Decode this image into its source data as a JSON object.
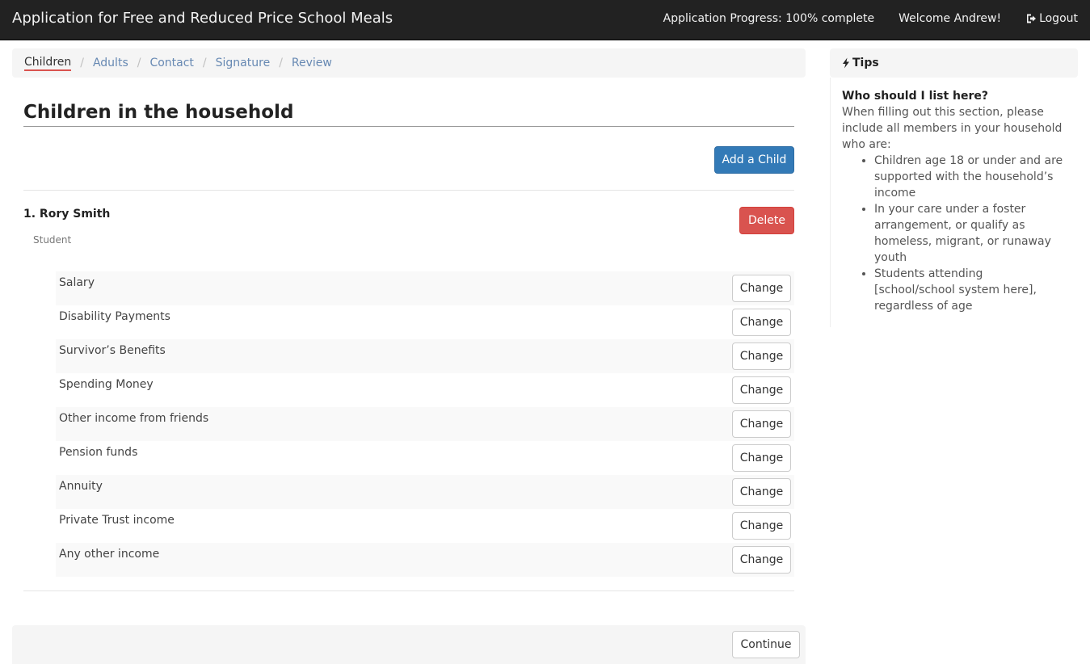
{
  "navbar": {
    "title": "Application for Free and Reduced Price School Meals",
    "progress": "Application Progress: 100% complete",
    "welcome": "Welcome Andrew!",
    "logout_label": "Logout"
  },
  "breadcrumb": {
    "items": [
      {
        "label": "Children",
        "active": true
      },
      {
        "label": "Adults",
        "active": false
      },
      {
        "label": "Contact",
        "active": false
      },
      {
        "label": "Signature",
        "active": false
      },
      {
        "label": "Review",
        "active": false
      }
    ],
    "separator": "/"
  },
  "main": {
    "heading": "Children in the household",
    "add_child_label": "Add a Child",
    "child": {
      "name": "1. Rory Smith",
      "role": "Student",
      "delete_label": "Delete",
      "income_sources": [
        {
          "label": "Salary",
          "action": "Change"
        },
        {
          "label": "Disability Payments",
          "action": "Change"
        },
        {
          "label": "Survivor’s Benefits",
          "action": "Change"
        },
        {
          "label": "Spending Money",
          "action": "Change"
        },
        {
          "label": "Other income from friends",
          "action": "Change"
        },
        {
          "label": "Pension funds",
          "action": "Change"
        },
        {
          "label": "Annuity",
          "action": "Change"
        },
        {
          "label": "Private Trust income",
          "action": "Change"
        },
        {
          "label": "Any other income",
          "action": "Change"
        }
      ]
    },
    "continue_label": "Continue"
  },
  "tips": {
    "title": "Tips",
    "question": "Who should I list here?",
    "intro": "When filling out this section, please include all members in your household who are:",
    "bullets": [
      "Children age 18 or under and are supported with the household’s income",
      "In your care under a foster arrangement, or qualify as homeless, migrant, or runaway youth",
      "Students attending [school/school system here], regardless of age"
    ]
  },
  "colors": {
    "navbar_bg": "#222222",
    "primary": "#337ab7",
    "danger": "#d9534f",
    "link": "#6789b3",
    "active_underline": "#d9534f"
  },
  "icons": {
    "logout": "logout-icon",
    "tips": "bolt-icon"
  }
}
